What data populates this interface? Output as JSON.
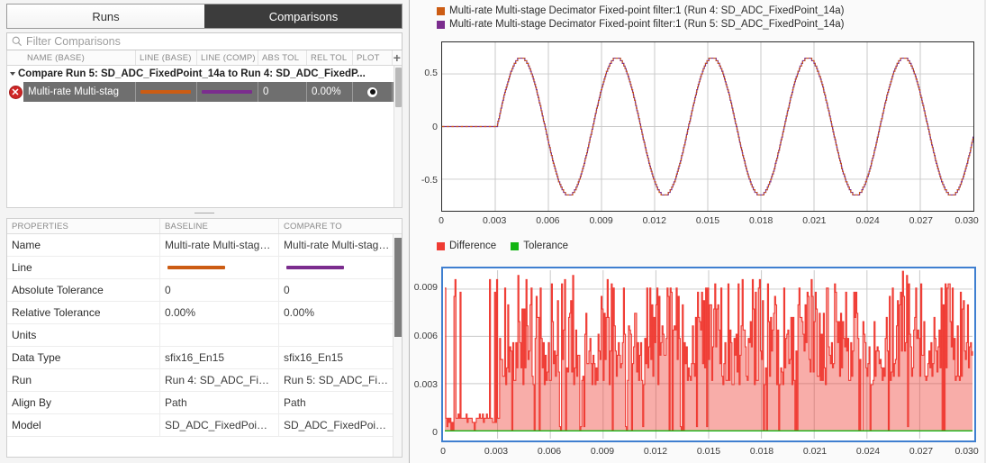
{
  "tabs": [
    {
      "label": "Runs",
      "active": false,
      "name": "tab-runs"
    },
    {
      "label": "Comparisons",
      "active": true,
      "name": "tab-comparisons"
    }
  ],
  "filter": {
    "placeholder": "Filter Comparisons",
    "value": "",
    "icon": "search-icon"
  },
  "tree": {
    "columns": [
      "NAME (BASE)",
      "LINE (BASE)",
      "LINE (COMP)",
      "ABS TOL",
      "REL TOL",
      "PLOT"
    ],
    "add_icon": "plus-icon",
    "group_label": "Compare Run 5: SD_ADC_FixedPoint_14a to Run 4: SD_ADC_FixedP...",
    "row": {
      "delete_icon": "delete-circle-icon",
      "name": "Multi-rate Multi-stag",
      "line_base_color": "#cc5c13",
      "line_comp_color": "#7b2d8e",
      "abs_tol": "0",
      "rel_tol": "0.00%",
      "plot_icon": "radio-selected-icon"
    }
  },
  "properties": {
    "columns": [
      "PROPERTIES",
      "BASELINE",
      "COMPARE TO"
    ],
    "rows": [
      {
        "label": "Name",
        "baseline": "Multi-rate Multi-stag…",
        "compare": "Multi-rate Multi-stag…"
      },
      {
        "label": "Line",
        "baseline": "",
        "compare": "",
        "type": "line"
      },
      {
        "label": "Absolute Tolerance",
        "baseline": "0",
        "compare": "0"
      },
      {
        "label": "Relative Tolerance",
        "baseline": "0.00%",
        "compare": "0.00%"
      },
      {
        "label": "Units",
        "baseline": "",
        "compare": ""
      },
      {
        "label": "Data Type",
        "baseline": "sfix16_En15",
        "compare": "sfix16_En15"
      },
      {
        "label": "Run",
        "baseline": "Run 4: SD_ADC_Fi…",
        "compare": "Run 5: SD_ADC_Fi…"
      },
      {
        "label": "Align By",
        "baseline": "Path",
        "compare": "Path"
      },
      {
        "label": "Model",
        "baseline": "SD_ADC_FixedPoi…",
        "compare": "SD_ADC_FixedPoi…"
      }
    ],
    "line_baseline_color": "#cc5c13",
    "line_compare_color": "#7b2d8e"
  },
  "chart_data": [
    {
      "type": "line",
      "name": "signal-comparison-plot",
      "title": "",
      "xlabel": "",
      "ylabel": "",
      "xlim": [
        0,
        0.03
      ],
      "ylim": [
        -0.8,
        0.8
      ],
      "xticks": [
        "0",
        "0.003",
        "0.006",
        "0.009",
        "0.012",
        "0.015",
        "0.018",
        "0.021",
        "0.024",
        "0.027",
        "0.030"
      ],
      "xtick_values": [
        0,
        0.003,
        0.006,
        0.009,
        0.012,
        0.015,
        0.018,
        0.021,
        0.024,
        0.027,
        0.03
      ],
      "yticks": [
        "0.5",
        "0",
        "-0.5"
      ],
      "ytick_values": [
        0.5,
        0,
        -0.5
      ],
      "grid": true,
      "legend_position": "above",
      "series": [
        {
          "name": "Multi-rate  Multi-stage  Decimator  Fixed-point filter:1 (Run 4: SD_ADC_FixedPoint_14a)",
          "color": "#cc5c13",
          "waveform": "staircase-sine",
          "amplitude": 0.655,
          "frequency_hz": 185,
          "start_time": 0.0031,
          "quantization_steps": 40
        },
        {
          "name": "Multi-rate  Multi-stage  Decimator  Fixed-point filter:1 (Run 5: SD_ADC_FixedPoint_14a)",
          "color": "#7b2d8e",
          "waveform": "staircase-sine",
          "amplitude": 0.655,
          "frequency_hz": 185,
          "start_time": 0.0031,
          "quantization_steps": 40
        }
      ]
    },
    {
      "type": "line",
      "name": "difference-plot",
      "title": "",
      "xlabel": "",
      "ylabel": "",
      "xlim": [
        0,
        0.03
      ],
      "ylim": [
        -0.0005,
        0.0102
      ],
      "xticks": [
        "0",
        "0.003",
        "0.006",
        "0.009",
        "0.012",
        "0.015",
        "0.018",
        "0.021",
        "0.024",
        "0.027",
        "0.030"
      ],
      "xtick_values": [
        0,
        0.003,
        0.006,
        0.009,
        0.012,
        0.015,
        0.018,
        0.021,
        0.024,
        0.027,
        0.03
      ],
      "yticks": [
        "0.009",
        "0.006",
        "0.003",
        "0"
      ],
      "ytick_values": [
        0.009,
        0.006,
        0.003,
        0
      ],
      "grid": true,
      "selected": true,
      "legend_position": "above",
      "series": [
        {
          "name": "Difference",
          "color": "#ef3b33",
          "max_value": 0.0096,
          "typical_value": 0.003
        },
        {
          "name": "Tolerance",
          "color": "#13b513",
          "constant_value": 0
        }
      ]
    }
  ]
}
